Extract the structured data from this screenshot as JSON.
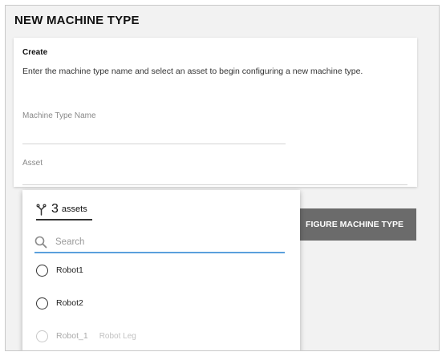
{
  "page": {
    "title": "NEW MACHINE TYPE"
  },
  "card": {
    "heading": "Create",
    "description": "Enter the machine type name and select an asset to begin configuring a new machine type.",
    "fields": {
      "machine_type_name": {
        "label": "Machine Type Name",
        "value": ""
      },
      "asset": {
        "label": "Asset",
        "value": ""
      }
    }
  },
  "configure_button": {
    "label": "FIGURE MACHINE TYPE"
  },
  "asset_dropdown": {
    "count": "3",
    "count_unit": "assets",
    "search": {
      "placeholder": "Search",
      "value": ""
    },
    "options": [
      {
        "label": "Robot1",
        "sub": "",
        "disabled": false
      },
      {
        "label": "Robot2",
        "sub": "",
        "disabled": false
      },
      {
        "label": "Robot_1",
        "sub": "Robot Leg",
        "disabled": true
      }
    ]
  },
  "icons": {
    "asset": "asset-tree-icon",
    "search": "search-icon",
    "radio": "radio-unchecked-icon"
  },
  "colors": {
    "button_bg": "#6b6b6b",
    "search_underline": "#5aa0dc",
    "panel_bg": "#f2f2f2"
  }
}
